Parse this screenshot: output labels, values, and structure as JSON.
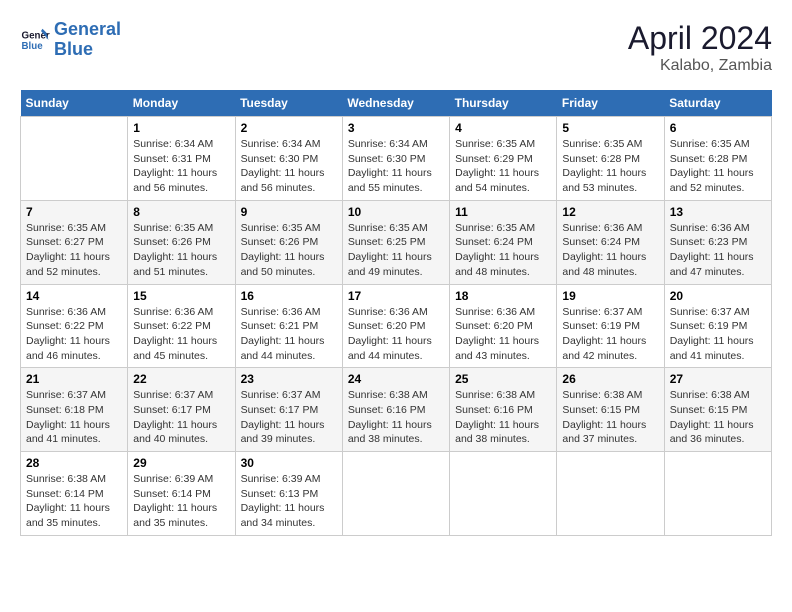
{
  "header": {
    "logo_line1": "General",
    "logo_line2": "Blue",
    "month": "April 2024",
    "location": "Kalabo, Zambia"
  },
  "weekdays": [
    "Sunday",
    "Monday",
    "Tuesday",
    "Wednesday",
    "Thursday",
    "Friday",
    "Saturday"
  ],
  "weeks": [
    [
      {
        "day": "",
        "info": ""
      },
      {
        "day": "1",
        "info": "Sunrise: 6:34 AM\nSunset: 6:31 PM\nDaylight: 11 hours\nand 56 minutes."
      },
      {
        "day": "2",
        "info": "Sunrise: 6:34 AM\nSunset: 6:30 PM\nDaylight: 11 hours\nand 56 minutes."
      },
      {
        "day": "3",
        "info": "Sunrise: 6:34 AM\nSunset: 6:30 PM\nDaylight: 11 hours\nand 55 minutes."
      },
      {
        "day": "4",
        "info": "Sunrise: 6:35 AM\nSunset: 6:29 PM\nDaylight: 11 hours\nand 54 minutes."
      },
      {
        "day": "5",
        "info": "Sunrise: 6:35 AM\nSunset: 6:28 PM\nDaylight: 11 hours\nand 53 minutes."
      },
      {
        "day": "6",
        "info": "Sunrise: 6:35 AM\nSunset: 6:28 PM\nDaylight: 11 hours\nand 52 minutes."
      }
    ],
    [
      {
        "day": "7",
        "info": "Sunrise: 6:35 AM\nSunset: 6:27 PM\nDaylight: 11 hours\nand 52 minutes."
      },
      {
        "day": "8",
        "info": "Sunrise: 6:35 AM\nSunset: 6:26 PM\nDaylight: 11 hours\nand 51 minutes."
      },
      {
        "day": "9",
        "info": "Sunrise: 6:35 AM\nSunset: 6:26 PM\nDaylight: 11 hours\nand 50 minutes."
      },
      {
        "day": "10",
        "info": "Sunrise: 6:35 AM\nSunset: 6:25 PM\nDaylight: 11 hours\nand 49 minutes."
      },
      {
        "day": "11",
        "info": "Sunrise: 6:35 AM\nSunset: 6:24 PM\nDaylight: 11 hours\nand 48 minutes."
      },
      {
        "day": "12",
        "info": "Sunrise: 6:36 AM\nSunset: 6:24 PM\nDaylight: 11 hours\nand 48 minutes."
      },
      {
        "day": "13",
        "info": "Sunrise: 6:36 AM\nSunset: 6:23 PM\nDaylight: 11 hours\nand 47 minutes."
      }
    ],
    [
      {
        "day": "14",
        "info": "Sunrise: 6:36 AM\nSunset: 6:22 PM\nDaylight: 11 hours\nand 46 minutes."
      },
      {
        "day": "15",
        "info": "Sunrise: 6:36 AM\nSunset: 6:22 PM\nDaylight: 11 hours\nand 45 minutes."
      },
      {
        "day": "16",
        "info": "Sunrise: 6:36 AM\nSunset: 6:21 PM\nDaylight: 11 hours\nand 44 minutes."
      },
      {
        "day": "17",
        "info": "Sunrise: 6:36 AM\nSunset: 6:20 PM\nDaylight: 11 hours\nand 44 minutes."
      },
      {
        "day": "18",
        "info": "Sunrise: 6:36 AM\nSunset: 6:20 PM\nDaylight: 11 hours\nand 43 minutes."
      },
      {
        "day": "19",
        "info": "Sunrise: 6:37 AM\nSunset: 6:19 PM\nDaylight: 11 hours\nand 42 minutes."
      },
      {
        "day": "20",
        "info": "Sunrise: 6:37 AM\nSunset: 6:19 PM\nDaylight: 11 hours\nand 41 minutes."
      }
    ],
    [
      {
        "day": "21",
        "info": "Sunrise: 6:37 AM\nSunset: 6:18 PM\nDaylight: 11 hours\nand 41 minutes."
      },
      {
        "day": "22",
        "info": "Sunrise: 6:37 AM\nSunset: 6:17 PM\nDaylight: 11 hours\nand 40 minutes."
      },
      {
        "day": "23",
        "info": "Sunrise: 6:37 AM\nSunset: 6:17 PM\nDaylight: 11 hours\nand 39 minutes."
      },
      {
        "day": "24",
        "info": "Sunrise: 6:38 AM\nSunset: 6:16 PM\nDaylight: 11 hours\nand 38 minutes."
      },
      {
        "day": "25",
        "info": "Sunrise: 6:38 AM\nSunset: 6:16 PM\nDaylight: 11 hours\nand 38 minutes."
      },
      {
        "day": "26",
        "info": "Sunrise: 6:38 AM\nSunset: 6:15 PM\nDaylight: 11 hours\nand 37 minutes."
      },
      {
        "day": "27",
        "info": "Sunrise: 6:38 AM\nSunset: 6:15 PM\nDaylight: 11 hours\nand 36 minutes."
      }
    ],
    [
      {
        "day": "28",
        "info": "Sunrise: 6:38 AM\nSunset: 6:14 PM\nDaylight: 11 hours\nand 35 minutes."
      },
      {
        "day": "29",
        "info": "Sunrise: 6:39 AM\nSunset: 6:14 PM\nDaylight: 11 hours\nand 35 minutes."
      },
      {
        "day": "30",
        "info": "Sunrise: 6:39 AM\nSunset: 6:13 PM\nDaylight: 11 hours\nand 34 minutes."
      },
      {
        "day": "",
        "info": ""
      },
      {
        "day": "",
        "info": ""
      },
      {
        "day": "",
        "info": ""
      },
      {
        "day": "",
        "info": ""
      }
    ]
  ]
}
